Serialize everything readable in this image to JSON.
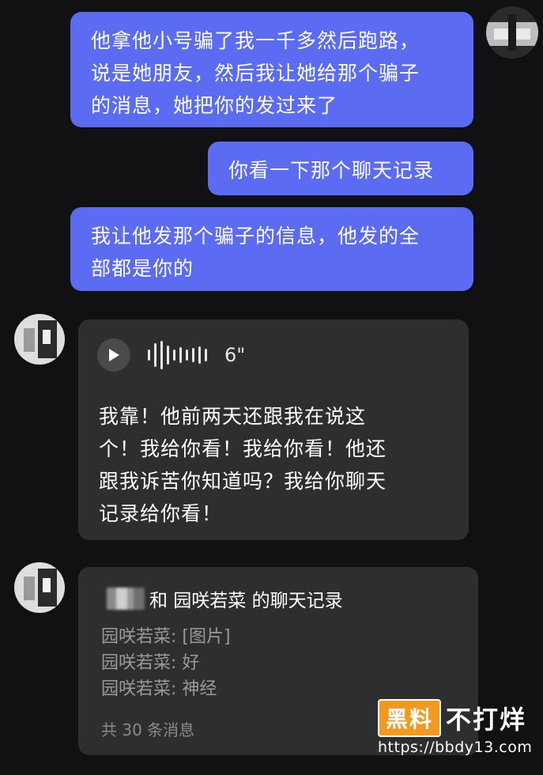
{
  "messages": {
    "out1_lines": [
      "他拿他小号骗了我一千多然后跑路，",
      "说是她朋友，然后我让她给那个骗子",
      "的消息，她把你的发过来了"
    ],
    "out2": "你看一下那个聊天记录",
    "out3_lines": [
      "我让他发那个骗子的信息，他发的全",
      "部都是你的"
    ]
  },
  "voice": {
    "duration": "6\"",
    "transcript_lines": [
      "我靠！他前两天还跟我在说这",
      "个！我给你看！我给你看！他还",
      "跟我诉苦你知道吗？我给你聊天",
      "记录给你看！"
    ]
  },
  "forward": {
    "title": "和 园咲若菜 的聊天记录",
    "lines": [
      "园咲若菜: [图片]",
      "园咲若菜: 好",
      "园咲若菜: 神经"
    ],
    "count": "共 30 条消息"
  },
  "watermark": {
    "badge": "黑料",
    "text": "不打烊",
    "url": "https://bbdy13.com"
  },
  "colors": {
    "background": "#111113",
    "outgoing_bubble": "#5b6cf2",
    "incoming_bubble": "#2e2e30"
  }
}
